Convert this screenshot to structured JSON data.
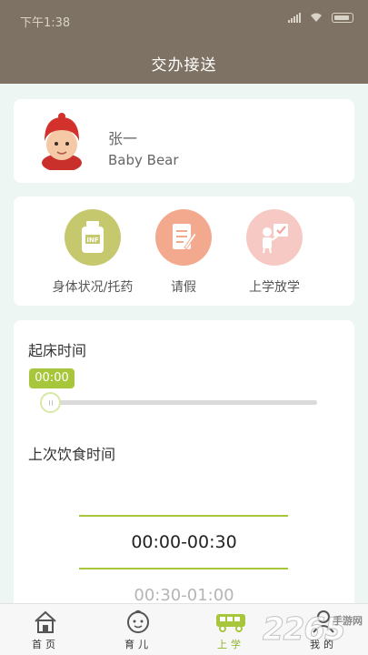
{
  "status_bar": {
    "time": "下午1:38"
  },
  "header": {
    "title": "交办接送"
  },
  "child": {
    "name": "张一",
    "english_name": "Baby Bear"
  },
  "actions": [
    {
      "label": "身体状况/托药",
      "icon": "medicine-bottle-icon",
      "color": "#c6c86d"
    },
    {
      "label": "请假",
      "icon": "leave-note-icon",
      "color": "#f3a98d"
    },
    {
      "label": "上学放学",
      "icon": "school-pickup-icon",
      "color": "#f7c9c4"
    }
  ],
  "form": {
    "wake_time_label": "起床时间",
    "wake_time_value": "00:00",
    "last_meal_label": "上次饮食时间",
    "meal_options": [
      "00:00-00:30",
      "00:30-01:00"
    ]
  },
  "tabs": [
    {
      "label": "首页",
      "icon": "home-icon",
      "active": false
    },
    {
      "label": "育儿",
      "icon": "baby-face-icon",
      "active": false
    },
    {
      "label": "上学",
      "icon": "school-bus-icon",
      "active": true
    },
    {
      "label": "我的",
      "icon": "profile-icon",
      "active": false
    }
  ],
  "watermark": {
    "big": "2265",
    "small": "手游网"
  },
  "colors": {
    "header": "#7d7263",
    "accent": "#a8c63b",
    "background": "#eef6f3"
  }
}
